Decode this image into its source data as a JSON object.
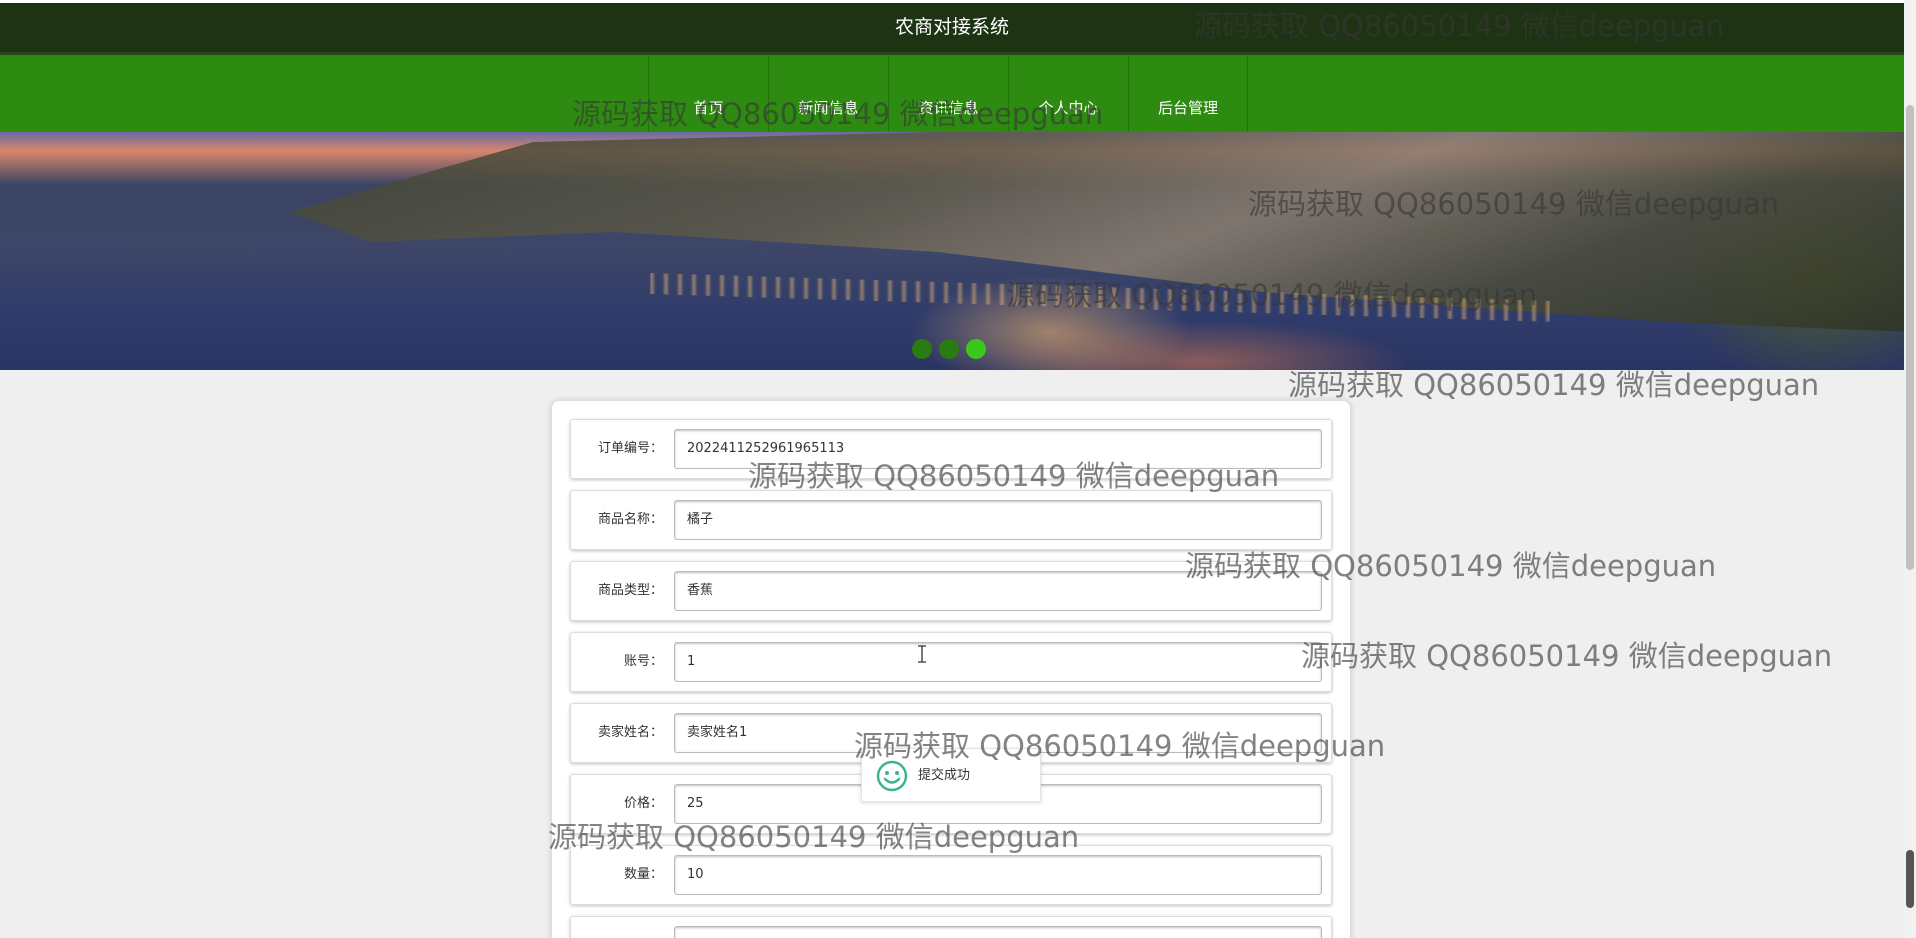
{
  "header": {
    "title": "农商对接系统"
  },
  "nav": {
    "items": [
      "首页",
      "新闻信息",
      "资讯信息",
      "个人中心",
      "后台管理"
    ]
  },
  "form": {
    "fields": [
      {
        "label": "订单编号：",
        "value": "2022411252961965113"
      },
      {
        "label": "商品名称：",
        "value": "橘子"
      },
      {
        "label": "商品类型：",
        "value": "香蕉"
      },
      {
        "label": "账号：",
        "value": "1"
      },
      {
        "label": "卖家姓名：",
        "value": "卖家姓名1"
      },
      {
        "label": "价格：",
        "value": "25"
      },
      {
        "label": "数量：",
        "value": "10"
      },
      {
        "label": "",
        "value": ""
      }
    ]
  },
  "toast": {
    "message": "提交成功"
  },
  "watermark": {
    "text": "源码获取 QQ86050149 微信deepguan"
  }
}
